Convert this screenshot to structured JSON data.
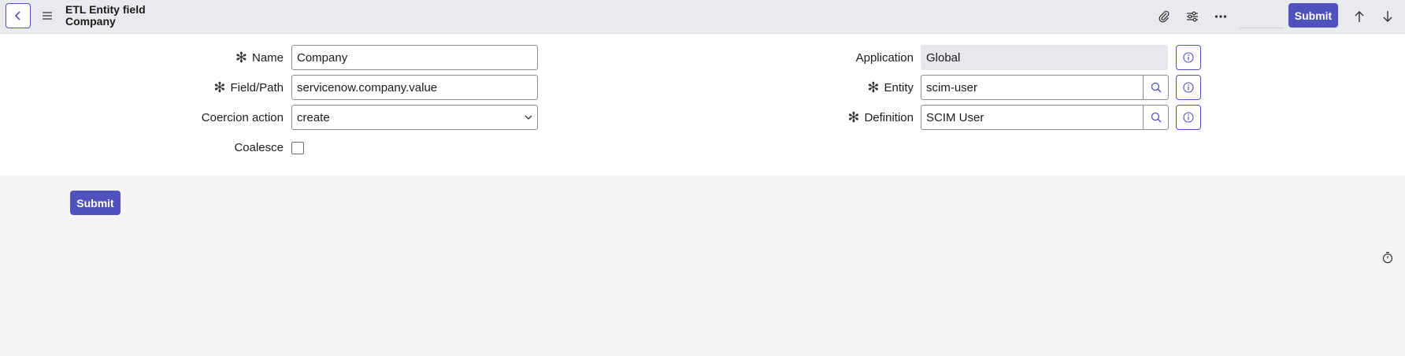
{
  "header": {
    "title_line1": "ETL Entity field",
    "title_line2": "Company",
    "submit_label": "Submit"
  },
  "icons": {
    "back": "chevron-left-icon",
    "menu": "hamburger-icon",
    "attachment": "paperclip-icon",
    "personalize": "sliders-icon",
    "more": "more-options-icon",
    "up": "arrow-up-icon",
    "down": "arrow-down-icon",
    "lookup": "search-icon",
    "info": "info-icon",
    "timer": "stopwatch-icon"
  },
  "colors": {
    "accent": "#4f52bd",
    "header_bg": "#e8eaee",
    "page_bg": "#f5f5f7"
  },
  "form": {
    "name": {
      "label": "Name",
      "value": "Company",
      "required": true
    },
    "field_path": {
      "label": "Field/Path",
      "value": "servicenow.company.value",
      "required": true
    },
    "coercion_action": {
      "label": "Coercion action",
      "value": "create"
    },
    "coalesce": {
      "label": "Coalesce",
      "checked": false
    },
    "application": {
      "label": "Application",
      "value": "Global"
    },
    "entity": {
      "label": "Entity",
      "value": "scim-user",
      "required": true
    },
    "definition": {
      "label": "Definition",
      "value": "SCIM User",
      "required": true
    }
  },
  "footer": {
    "submit_label": "Submit"
  }
}
